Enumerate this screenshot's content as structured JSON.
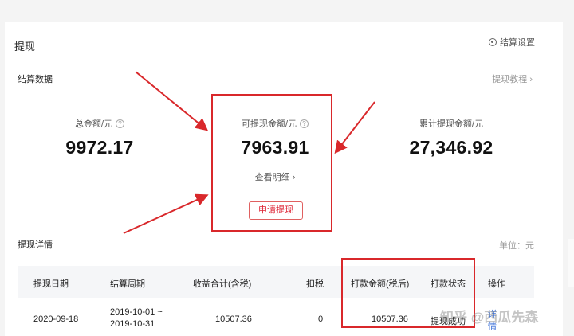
{
  "header": {
    "title": "提现",
    "settings_label": "结算设置"
  },
  "settlement": {
    "title": "结算数据",
    "tutorial_link": "提现教程 ›",
    "total_label": "总金额/元",
    "total_value": "9972.17",
    "available_label": "可提现金额/元",
    "available_value": "7963.91",
    "cumulative_label": "累计提现金额/元",
    "cumulative_value": "27,346.92",
    "help_icon_glyph": "?",
    "details_link": "查看明细 ›",
    "apply_button": "申请提现"
  },
  "withdraw_details": {
    "title": "提现详情",
    "unit": "单位：元",
    "columns": [
      "提现日期",
      "结算周期",
      "收益合计(含税)",
      "扣税",
      "打款金额(税后)",
      "打款状态",
      "操作"
    ],
    "rows": [
      {
        "date": "2020-09-18",
        "period_start": "2019-10-01 ~",
        "period_end": "2019-10-31",
        "income": "10507.36",
        "tax": "0",
        "payout": "10507.36",
        "status": "提现成功",
        "action_line1": "详",
        "action_line2": "情"
      }
    ]
  },
  "watermark": "知乎 @西瓜先森",
  "colors": {
    "highlight_red": "#d9282b",
    "link_blue": "#3a6fd8",
    "button_red": "#dd2233"
  }
}
